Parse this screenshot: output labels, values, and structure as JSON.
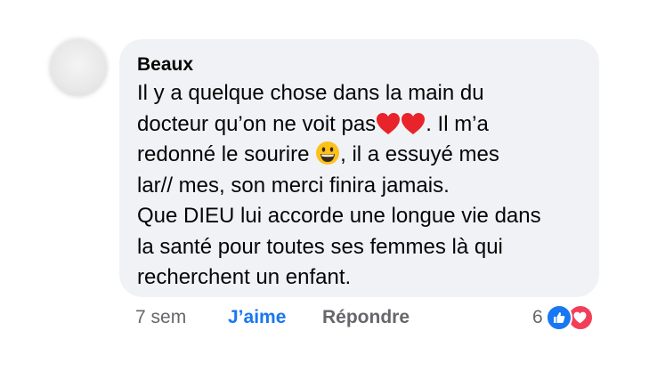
{
  "comment": {
    "author": "Beaux",
    "lines": [
      "Il y a quelque chose dans la main du",
      "docteur qu’on ne voit pas",
      ". Il m’a",
      "redonné le sourire",
      ", il a essuyé mes",
      "lar// mes, son merci finira jamais.",
      "Que DIEU lui accorde une longue vie dans",
      "la santé pour toutes ses femmes là qui",
      "recherchent un enfant."
    ],
    "emojis": [
      "red-heart",
      "red-heart",
      "grinning-face"
    ]
  },
  "actions": {
    "time": "7 sem",
    "like_label": "J’aime",
    "reply_label": "Répondre"
  },
  "reactions": {
    "count": "6",
    "types": [
      "like",
      "love"
    ]
  },
  "colors": {
    "bubble": "#f0f2f5",
    "text": "#050505",
    "meta": "#65676b",
    "like_blue": "#1877f2",
    "love_red": "#f33e58"
  }
}
